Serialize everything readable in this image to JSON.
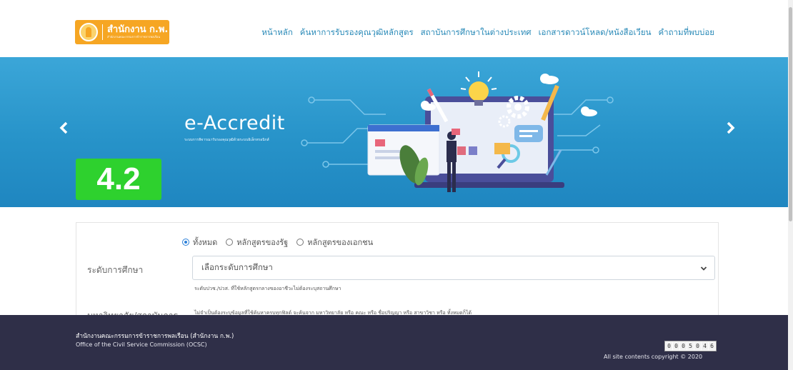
{
  "header": {
    "logo_text": "สำนักงาน ก.พ.",
    "logo_subtext": "สำนักงานคณะกรรมการข้าราชการพลเรือน",
    "nav": [
      "หน้าหลัก",
      "ค้นหาการรับรองคุณวุฒิหลักสูตร",
      "สถาบันการศึกษาในต่างประเทศ",
      "เอกสารดาวน์โหลด/หนังสือเวียน",
      "คำถามที่พบบ่อย"
    ]
  },
  "banner": {
    "title": "e-Accredit",
    "subtitle": "ระบบการพิจารณารับรองคุณวุฒิด้วยระบบอิเล็กทรอนิกส์",
    "version_badge": "4.2",
    "prev_icon": "chevron-left-icon",
    "next_icon": "chevron-right-icon"
  },
  "search_form": {
    "radio_options": [
      {
        "label": "ทั้งหมด",
        "checked": true
      },
      {
        "label": "หลักสูตรของรัฐ",
        "checked": false
      },
      {
        "label": "หลักสูตรของเอกชน",
        "checked": false
      }
    ],
    "education_level_label": "ระดับการศึกษา",
    "education_level_placeholder": "เลือกระดับการศึกษา",
    "education_level_help": "ระดับปวช./ปวส. ที่ใช้หลักสูตรกลางของอาชีวะไม่ต้องระบุสถานศึกษา",
    "university_label": "มหาวิทยาลัย/สถาบันการ",
    "university_help": "ไม่จำเป็นต้องระบุข้อมูลที่ใช้ค้นหาครบทุกฟิลด์ จะค้นจาก มหาวิทยาลัย หรือ คณะ หรือ ชื่อปริญญา หรือ สาขาวิชา หรือ ทั้งหมดก็ได้"
  },
  "footer": {
    "org_th": "สำนักงานคณะกรรมการข้าราชการพลเรือน (สำนักงาน ก.พ.)",
    "org_en": "Office of the Civil Service Commission (OCSC)",
    "visitor_counter": [
      "0",
      "0",
      "0",
      "5",
      "0",
      "4",
      "6"
    ],
    "copyright": "All site contents copyright © 2020"
  },
  "colors": {
    "brand_orange": "#f6a623",
    "nav_link": "#2a8ab8",
    "banner_blue": "#2793c9",
    "badge_green": "#2ed12e",
    "footer_bg": "#2f2f48",
    "radio_accent": "#2b7fd8"
  }
}
